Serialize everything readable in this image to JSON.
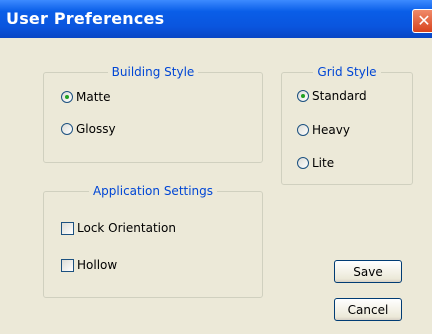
{
  "window": {
    "title": "User Preferences",
    "close_icon": "close-icon"
  },
  "building_style": {
    "legend": "Building Style",
    "options": [
      {
        "label": "Matte",
        "checked": true
      },
      {
        "label": "Glossy",
        "checked": false
      }
    ]
  },
  "grid_style": {
    "legend": "Grid Style",
    "options": [
      {
        "label": "Standard",
        "checked": true
      },
      {
        "label": "Heavy",
        "checked": false
      },
      {
        "label": "Lite",
        "checked": false
      }
    ]
  },
  "app_settings": {
    "legend": "Application Settings",
    "options": [
      {
        "label": "Lock Orientation",
        "checked": false
      },
      {
        "label": "Hollow",
        "checked": false
      }
    ]
  },
  "buttons": {
    "save": "Save",
    "cancel": "Cancel"
  },
  "colors": {
    "title_bar": "#0a5ee8",
    "legend_text": "#0046d5",
    "close_button": "#d8431d",
    "radio_dot": "#21a121"
  }
}
